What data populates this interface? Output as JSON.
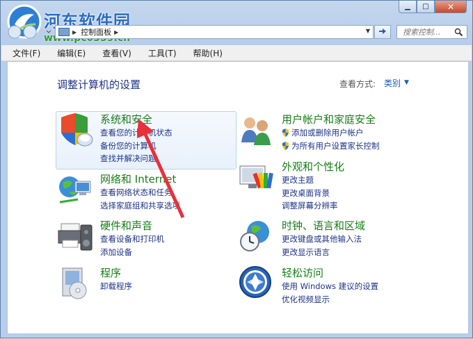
{
  "watermark": {
    "title": "河东软件园",
    "url": "www.pc0359.cn"
  },
  "window": {
    "caption_min": "▁",
    "caption_max": "□",
    "caption_close": "✕"
  },
  "address_bar": {
    "path": "控制面板",
    "separator": "▶"
  },
  "search": {
    "placeholder": "搜索控制..."
  },
  "menubar": {
    "items": [
      "文件(F)",
      "编辑(E)",
      "查看(V)",
      "工具(T)",
      "帮助(H)"
    ]
  },
  "content": {
    "title": "调整计算机的设置",
    "view_by_label": "查看方式:",
    "view_by_value": "类别"
  },
  "categories": {
    "system": {
      "title": "系统和安全",
      "links": [
        "查看您的计算机状态",
        "备份您的计算机",
        "查找并解决问题"
      ]
    },
    "network": {
      "title": "网络和 Internet",
      "links": [
        "查看网络状态和任务",
        "选择家庭组和共享选项"
      ]
    },
    "hardware": {
      "title": "硬件和声音",
      "links": [
        "查看设备和打印机",
        "添加设备"
      ]
    },
    "programs": {
      "title": "程序",
      "links": [
        "卸载程序"
      ]
    },
    "users": {
      "title": "用户帐户和家庭安全",
      "links": [
        "添加或删除用户帐户",
        "为所有用户设置家长控制"
      ]
    },
    "appearance": {
      "title": "外观和个性化",
      "links": [
        "更改主题",
        "更改桌面背景",
        "调整屏幕分辨率"
      ]
    },
    "clock": {
      "title": "时钟、语言和区域",
      "links": [
        "更改键盘或其他输入法",
        "更改显示语言"
      ]
    },
    "ease": {
      "title": "轻松访问",
      "links": [
        "使用 Windows 建议的设置",
        "优化视频显示"
      ]
    }
  },
  "colors": {
    "category_title": "#167d16",
    "link": "#1e3287",
    "annotation_arrow": "#e8303a"
  }
}
